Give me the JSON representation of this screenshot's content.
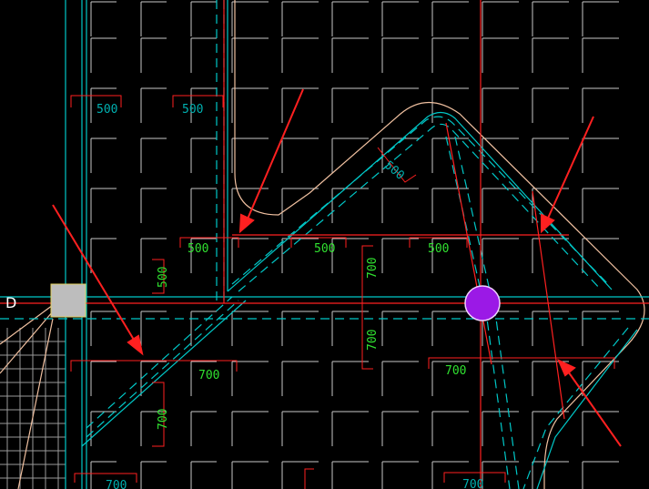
{
  "drawing": {
    "edge_label": "D",
    "dimensions": {
      "d1": "500",
      "d2": "500",
      "d3": "500",
      "d4": "500",
      "d5": "500",
      "d6": "500",
      "d7": "500",
      "d8": "700",
      "d9": "700",
      "d10": "700",
      "d11": "700",
      "d12": "700",
      "d13": "700",
      "d14": "700"
    }
  },
  "colors": {
    "background": "#000000",
    "grid": "#c8c8c8",
    "structure": "#00c8c8",
    "red": "#ff2020",
    "dim_green": "#30e030",
    "dim_cyan": "#00b0b0",
    "marker_circle": "#9b19e6",
    "marker_square": "#bdbdbd",
    "outline": "#f0c0a0"
  },
  "icons": {
    "marker_circle": "purple-circle-marker",
    "marker_square": "grey-square-marker",
    "arrows": "red-arrow"
  }
}
